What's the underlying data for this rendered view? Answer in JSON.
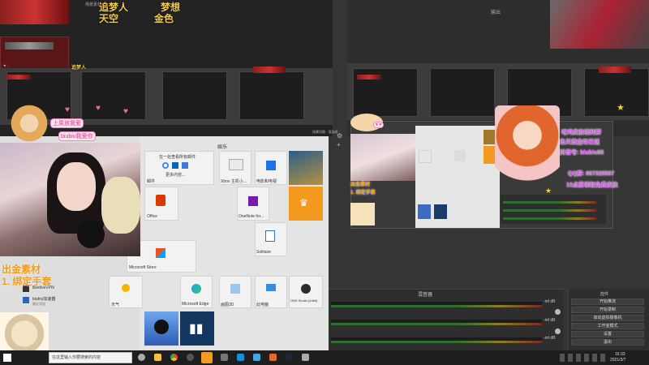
{
  "obs": {
    "top_left_label": "场景素材",
    "top_right_label": "输出",
    "scene_hint": "场景",
    "mixer_title": "混音器",
    "mixer_db": [
      "-inf dB",
      "-inf dB",
      "-inf dB"
    ],
    "controls_title": "控件",
    "controls": [
      "开始推流",
      "开始录制",
      "启动虚拟摄像机",
      "工作室模式",
      "设置",
      "退出"
    ],
    "status_small": "场景切换 · 渲染帧"
  },
  "overlay_text": {
    "chase_dream": "追梦人",
    "dream": "梦想",
    "sky": "天空",
    "golden": "金色",
    "chase_dream_small": "追梦人",
    "dream_small": "梦想",
    "sky_small": "天空",
    "golden_small": "金色",
    "thanks_tag": "上周放我爱",
    "love_tag": "biubiu我爱你",
    "yellow_bottom1": "出金素材",
    "yellow_bottom2": "1. 绑定手套",
    "preview_yellow1": "出金素材",
    "preview_yellow2": "1. 绑定手套",
    "right_lines": [
      "吃鸡皮肤福利群",
      "鱼天蛋盒每日送",
      "抖音号: biubiu88",
      "QQ群: 667325567",
      "12点后领取免费皮肤"
    ]
  },
  "start_menu": {
    "header": "娱乐",
    "mail_tile_line1": "在一处查看所有邮件",
    "mail_tile_line2": "更多内容...",
    "mail_label": "邮件",
    "xbox_label": "Xbox 主机小...",
    "movies_label": "电影和电视",
    "office_label": "Office",
    "onenote_label": "OneNote for...",
    "solitaire_label": "Solitaire",
    "store_label": "Microsoft Store",
    "weather_label": "天气",
    "edge_label": "Microsoft Edge",
    "paint_label": "画图3D",
    "pc_label": "此电脑",
    "obs_label": "OBS Studio (64bit)",
    "beelive_label": "BeeliveVPN",
    "biubiu_label": "biubiu加速器",
    "biubiu_sub": "最近添加"
  },
  "taskbar": {
    "search_placeholder": "在这里输入你要搜索的内容",
    "time": "16:33",
    "date": "2021/3/7"
  },
  "colors": {
    "accent_yellow": "#f2c84b",
    "obs_bg": "#353535",
    "taskbar": "#1e1e1e"
  }
}
